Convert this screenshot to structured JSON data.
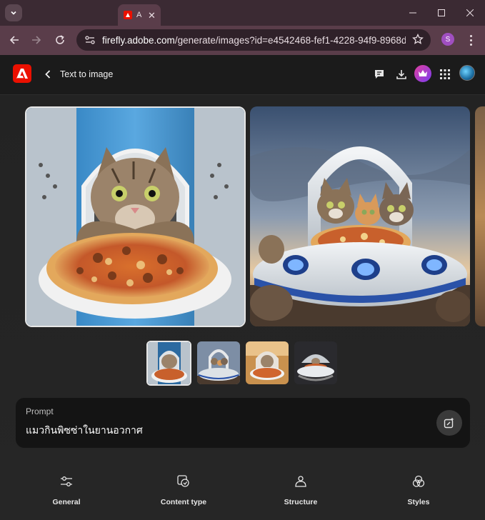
{
  "browser": {
    "tab_title": "A",
    "url_host": "firefly.adobe.com",
    "url_rest": "/generate/images?id=e4542468-fef1-4228-94f9-8968d25a1...",
    "profile_initial": "S"
  },
  "app": {
    "title": "Text to image",
    "brand_color": "#eb1000"
  },
  "gallery": {
    "main_image": "cat-with-pizza-in-spaceship",
    "second_image": "three-cats-with-pizza-in-ufo",
    "thumbnails": [
      "thumb-1-selected",
      "thumb-2",
      "thumb-3",
      "thumb-4"
    ]
  },
  "prompt": {
    "label": "Prompt",
    "text": "แมวกินพิซซ่าในยานอวกาศ"
  },
  "bottom_nav": [
    {
      "label": "General",
      "icon": "sliders-icon"
    },
    {
      "label": "Content type",
      "icon": "content-type-icon"
    },
    {
      "label": "Structure",
      "icon": "structure-icon"
    },
    {
      "label": "Styles",
      "icon": "styles-icon"
    }
  ]
}
